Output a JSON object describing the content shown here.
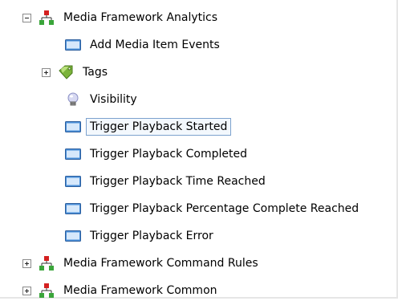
{
  "tree": {
    "items": [
      {
        "label": "Media Framework Analytics"
      },
      {
        "label": "Add Media Item Events"
      },
      {
        "label": "Tags"
      },
      {
        "label": "Visibility"
      },
      {
        "label": "Trigger Playback Started"
      },
      {
        "label": "Trigger Playback Completed"
      },
      {
        "label": "Trigger Playback Time Reached"
      },
      {
        "label": "Trigger Playback Percentage Complete Reached"
      },
      {
        "label": "Trigger Playback Error"
      },
      {
        "label": "Media Framework Command Rules"
      },
      {
        "label": "Media Framework Common"
      }
    ]
  },
  "colors": {
    "selection_border": "#7da2ce",
    "selection_fill": "#f3f8fd",
    "hierarchy_red": "#d42020",
    "hierarchy_green": "#3aa53a",
    "event_blue": "#4a8fd8"
  },
  "icons": {
    "group": "hierarchy-icon",
    "event": "event-window-icon",
    "tags": "tag-icon",
    "visibility": "lightbulb-icon"
  }
}
